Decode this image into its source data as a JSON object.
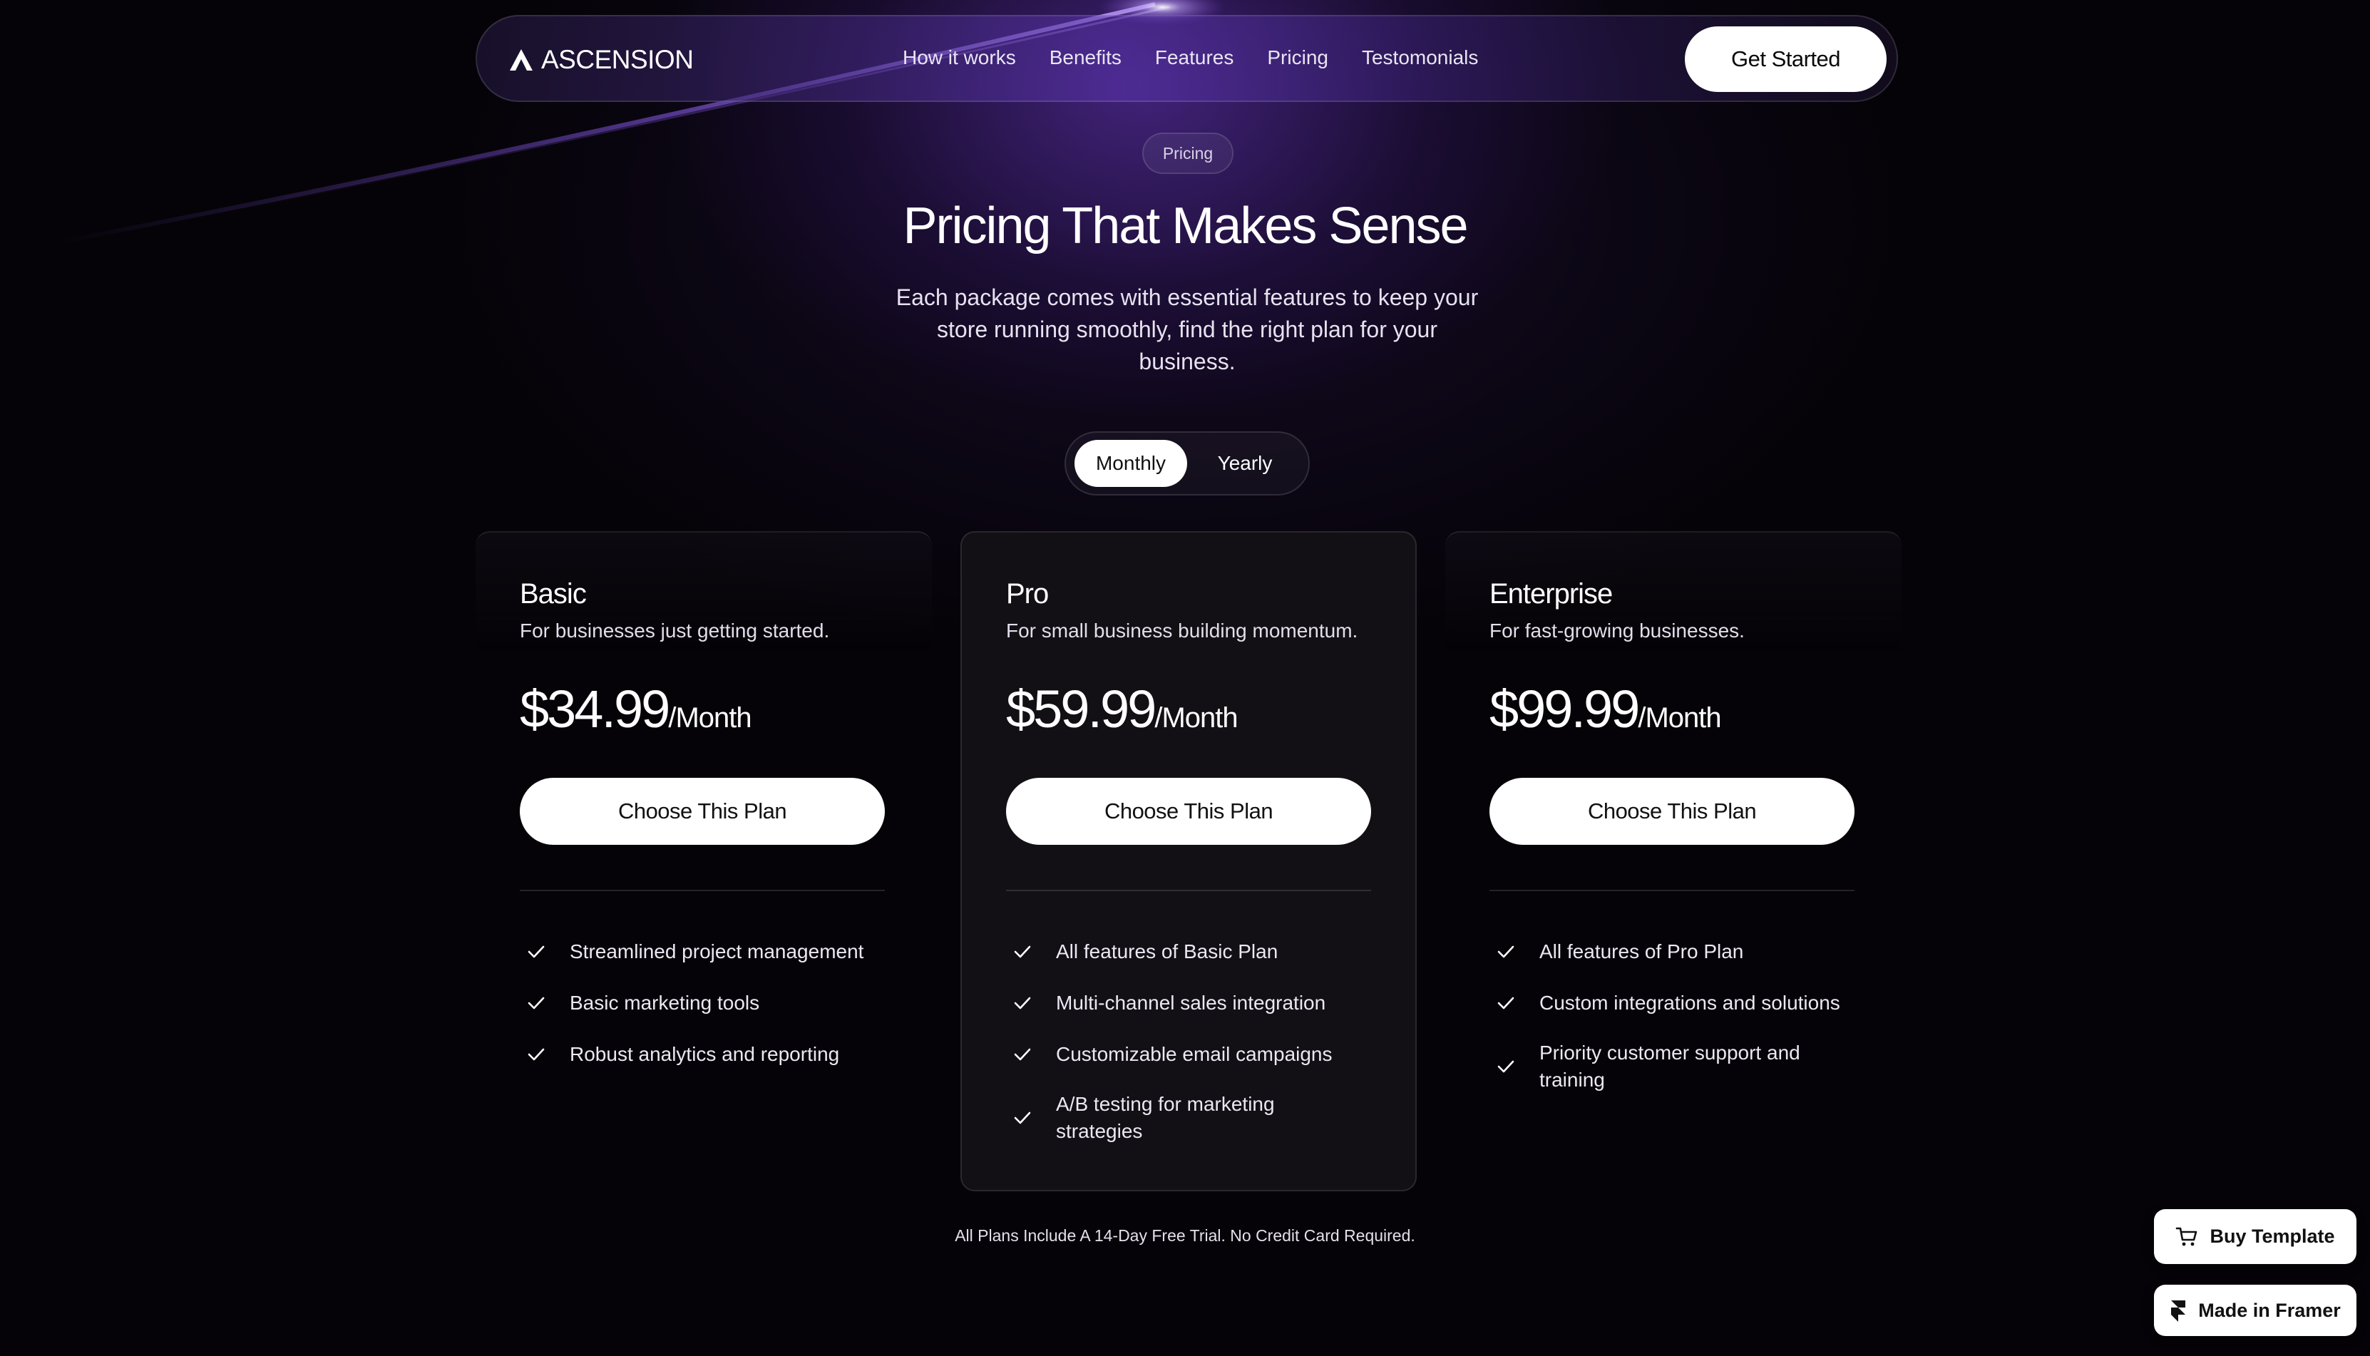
{
  "brand": {
    "name": "ASCENSION",
    "logo_icon": "triangle-logo-icon"
  },
  "nav": {
    "links": [
      "How it works",
      "Benefits",
      "Features",
      "Pricing",
      "Testomonials"
    ],
    "cta_label": "Get Started"
  },
  "hero": {
    "tag": "Pricing",
    "title": "Pricing That Makes Sense",
    "subtitle": "Each package comes with essential features to keep your store running smoothly, find the right plan for your business."
  },
  "billing_toggle": {
    "options": [
      "Monthly",
      "Yearly"
    ],
    "selected": "Monthly"
  },
  "plans": [
    {
      "name": "Basic",
      "description": "For businesses just getting started.",
      "price": "$34.99",
      "period": "/Month",
      "cta": "Choose This Plan",
      "features": [
        "Streamlined project management",
        "Basic marketing tools",
        "Robust analytics and reporting"
      ]
    },
    {
      "name": "Pro",
      "description": "For small business building momentum.",
      "price": "$59.99",
      "period": "/Month",
      "cta": "Choose This Plan",
      "features": [
        "All features of Basic Plan",
        "Multi-channel sales integration",
        "Customizable email campaigns",
        "A/B testing for marketing strategies"
      ]
    },
    {
      "name": "Enterprise",
      "description": "For fast-growing businesses.",
      "price": "$99.99",
      "period": "/Month",
      "cta": "Choose This Plan",
      "features": [
        "All features of Pro Plan",
        "Custom integrations and solutions",
        "Priority customer support and training"
      ]
    }
  ],
  "footer_note": "All Plans Include A 14-Day Free Trial. No Credit Card Required.",
  "badges": {
    "buy_template": "Buy Template",
    "made_in_framer": "Made in Framer"
  },
  "colors": {
    "background": "#050307",
    "accent_purple": "#6a38c4",
    "button_bg": "#ffffff",
    "highlight_card": "#121015"
  }
}
